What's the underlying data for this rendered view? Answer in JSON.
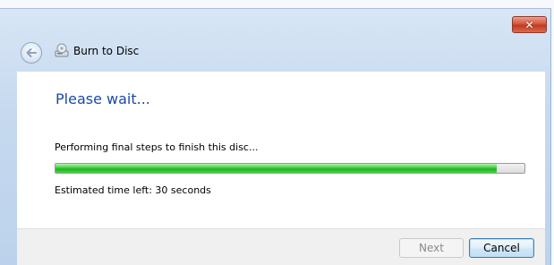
{
  "window": {
    "title": "Burn to Disc",
    "close_glyph": "✕"
  },
  "icons": {
    "back": "back-arrow-icon",
    "title": "burn-disc-icon",
    "close": "close-icon"
  },
  "content": {
    "heading": "Please wait...",
    "status": "Performing final steps to finish this disc...",
    "progress_fraction": 0.94,
    "time_left": "Estimated time left: 30 seconds"
  },
  "footer": {
    "next_label": "Next",
    "cancel_label": "Cancel"
  },
  "colors": {
    "heading": "#1b49a5",
    "progress_green": "#17b81a",
    "close_red": "#c23a1f"
  }
}
